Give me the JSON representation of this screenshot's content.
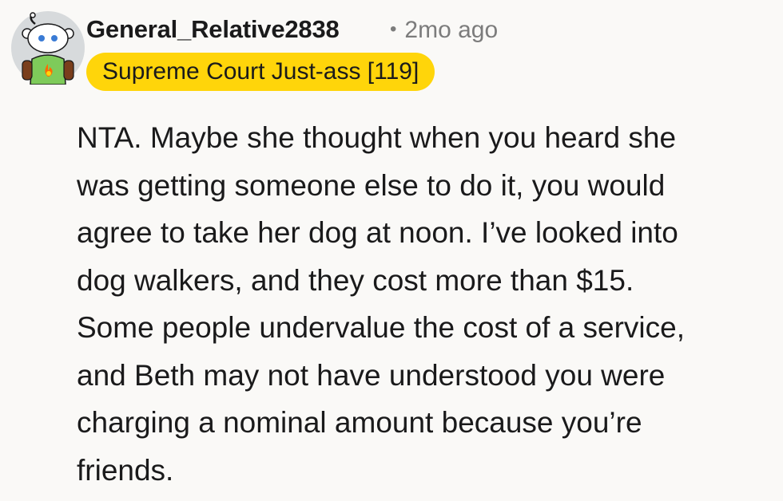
{
  "comment": {
    "username": "General_Relative2838",
    "separator": "•",
    "timestamp": "2mo ago",
    "flair": "Supreme Court Just-ass [119]",
    "body": "NTA. Maybe she thought when you heard she\nwas getting someone else to do it, you would\nagree to take her dog at noon. I’ve looked into\ndog walkers, and they cost more than $15.\nSome people undervalue the cost of a service,\nand Beth may not have understood you were\ncharging a nominal amount because you’re\nfriends.",
    "avatar_icon": "snoo-avatar-icon"
  },
  "colors": {
    "background": "#faf9f7",
    "flair_background": "#ffd50a",
    "meta_text": "#7c7c7c",
    "primary_text": "#1a1a1b"
  }
}
